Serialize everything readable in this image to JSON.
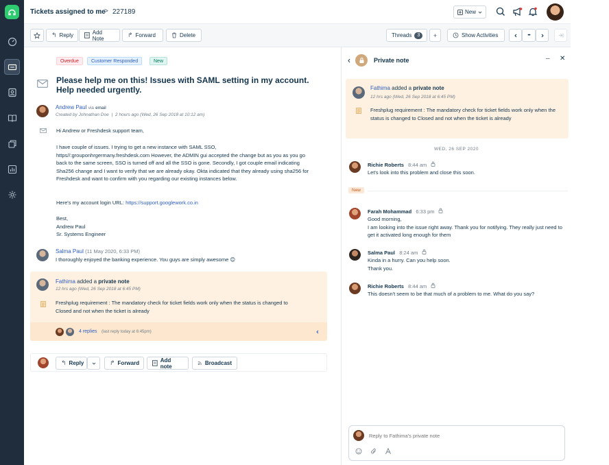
{
  "header": {
    "title": "Tickets assigned to me",
    "separator": ">",
    "ticket_id": "227189",
    "new_label": "New"
  },
  "toolbar": {
    "reply": "Reply",
    "add_note": "Add Note",
    "forward": "Forward",
    "delete": "Delete",
    "threads": "Threads",
    "threads_count": "3",
    "show_activities": "Show Activities",
    "more": "•••"
  },
  "ticket": {
    "tags": [
      "Overdue",
      "Customer Responded",
      "New"
    ],
    "subject": "Please help me on this! Issues with SAML setting in my account. Help needed urgently.",
    "sender_name": "Andrew Paul",
    "via": "via",
    "via_channel": "email",
    "created_meta": "Created by Johnathan Doe",
    "time_meta": "2 hours ago (Wed, 26 Sep 2018 at 10:12 am)",
    "greeting": "Hi Andrew or Freshdesk support team,",
    "body": "I have couple of issues. I trying to get a new instance with SAML SSO, https//:grouponhrgermany.freshdesk.com However, the ADMIN gui accepted the change but as you as you go back to the same screen, SSO is turned off and all the SSO is gone. Secondly, I got couple email indicating Sha256 change and I want to verify that we are already okay. Okta indicated that they already using sha256 for Freshdesk and want to confirm with you regarding our existing instances below.",
    "login_prefix": "Here's my account login URL: ",
    "login_url": "https://support.googlework.co.in",
    "sign_best": "Best,",
    "sign_name": "Andrew Paul",
    "sign_role": "Sr. Systems Engineer"
  },
  "comment": {
    "name": "Salma Paul",
    "time": "(11 May 2020, 6:33 PM)",
    "text": "I thoroughly enjoyed the banking experience. You guys are simply awesome 😊"
  },
  "private_note": {
    "author": "Fathima",
    "added": "added a",
    "kind": "private note",
    "time": "12 hrs ago (Wed, 26 Sep 2018 at 6:45 PM)",
    "text": "Freshplug requirement : The mandatory check for ticket fields work only when the status is changed to Closed and not when the ticket is already",
    "replies": "4 replies",
    "last_reply": "(last reply today at 6:45pm)"
  },
  "reply_bar": {
    "reply": "Reply",
    "forward": "Forward",
    "add_note": "Add note",
    "broadcast": "Broadcast"
  },
  "panel": {
    "title": "Private note",
    "note_author": "Fathima",
    "note_added": "added a",
    "note_kind": "private note",
    "note_time": "12 hrs ago (Wed, 26 Sep 2018 at 6:45 PM)",
    "note_text": "Freshplug requirement : The mandatory check for ticket fields work only when the status is changed to Closed and not when the ticket is already",
    "date_sep": "WED, 26 SEP 2020",
    "new_label": "New",
    "messages": [
      {
        "name": "Richie Roberts",
        "time": "8:44 am",
        "text": "Let's look into this problem and close this soon."
      },
      {
        "name": "Farah Mohammad",
        "time": "6:33 pm",
        "text": "Good morning,\nI am looking into the issue right away. Thank you for notifying. They really just need to get it activated long enough for them"
      },
      {
        "name": "Salma Paul",
        "time": "8:24 am",
        "text": "Kinda in a hurry. Can you help soon.\nThank you."
      },
      {
        "name": "Richie Roberts",
        "time": "8:44 am",
        "text": "This doesn't seem to be that much of a problem to me. What do you say?"
      }
    ],
    "reply_placeholder": "Reply to Fathima's private note"
  }
}
